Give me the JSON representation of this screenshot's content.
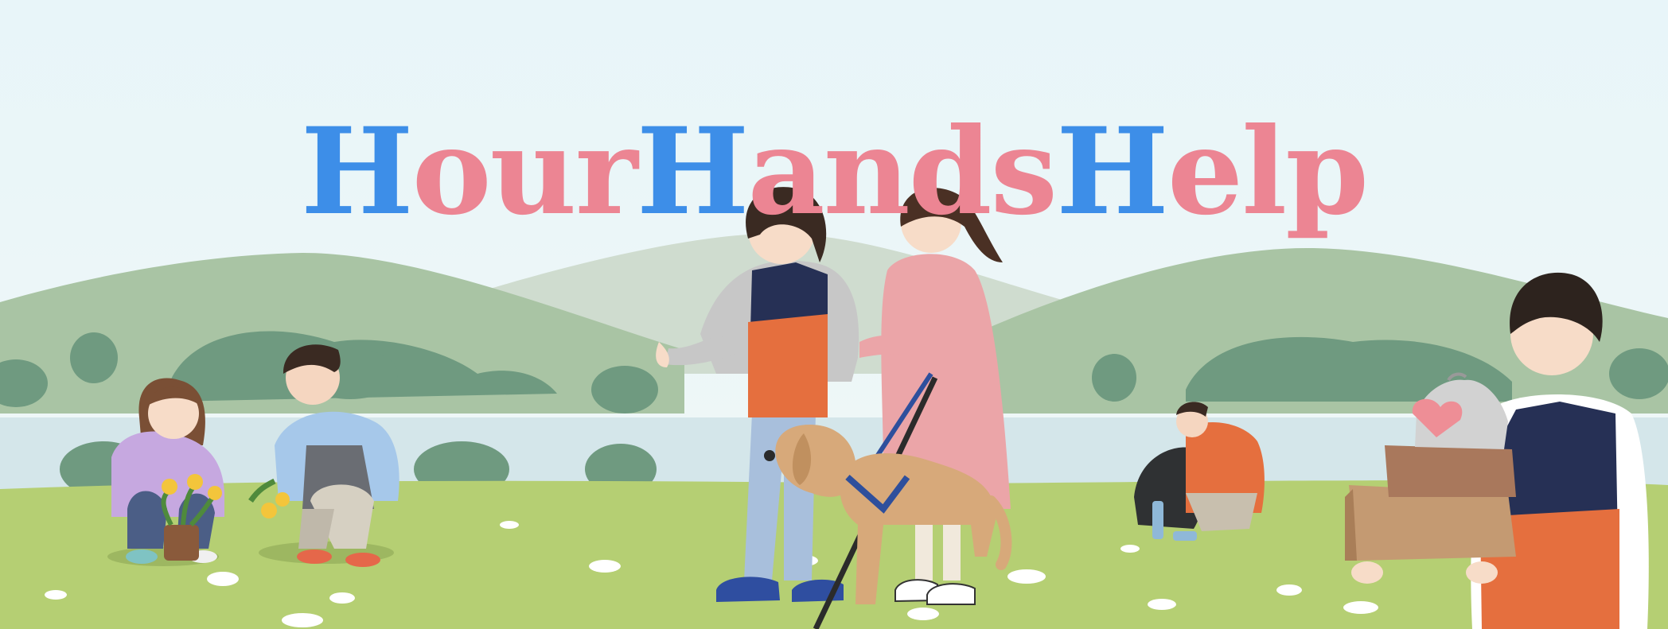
{
  "logo": {
    "parts": [
      {
        "cap": "H",
        "rest": "our"
      },
      {
        "cap": "H",
        "rest": "ands"
      },
      {
        "cap": "H",
        "rest": "elp"
      }
    ]
  },
  "colors": {
    "sky": "#e6f4f8",
    "logo_capital": "#3d8ee8",
    "logo_lowercase": "#ec8593",
    "hill_back": "#cfdccf",
    "hill_mid": "#a9c4a4",
    "trees": "#6f9a80",
    "lake": "#d4e6ea",
    "meadow": "#b5cf73",
    "vest_navy": "#263055",
    "vest_orange": "#e56f3e",
    "dress_pink": "#eba5a8",
    "dog": "#d7a97a"
  },
  "scene": {
    "people": [
      {
        "name": "girl-planting-flowers",
        "icon": "gardening-girl-icon"
      },
      {
        "name": "boy-planting-flowers",
        "icon": "gardening-boy-icon"
      },
      {
        "name": "volunteer-guide",
        "icon": "volunteer-guide-icon"
      },
      {
        "name": "woman-with-cane",
        "icon": "visually-impaired-woman-icon"
      },
      {
        "name": "trash-picker",
        "icon": "trash-picker-icon"
      },
      {
        "name": "box-carrier",
        "icon": "box-carrier-icon"
      }
    ],
    "animals": [
      {
        "name": "guide-dog",
        "icon": "guide-dog-icon"
      }
    ]
  }
}
